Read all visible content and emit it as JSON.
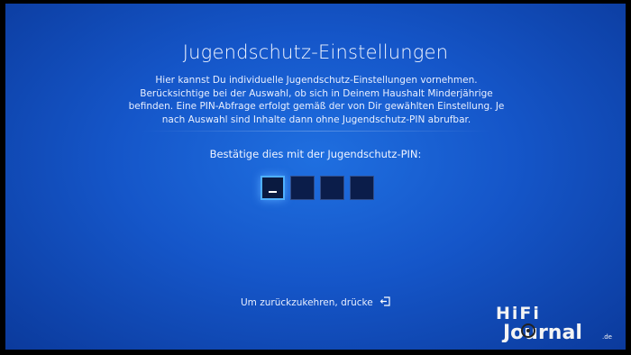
{
  "screen": {
    "title": "Jugendschutz-Einstellungen",
    "description": "Hier kannst Du individuelle Jugendschutz-Einstellungen vornehmen. Berücksichtige bei der Auswahl, ob sich in Deinem Haushalt Minderjährige befinden. Eine PIN-Abfrage erfolgt gemäß der von Dir gewählten Einstellung. Je nach Auswahl sind Inhalte dann ohne Jugendschutz-PIN abrufbar.",
    "pin_prompt": "Bestätige dies mit der Jugendschutz-PIN:",
    "pin_digits": 4,
    "back_hint": "Um zurückzukehren, drücke"
  },
  "watermark": {
    "line1": "HiFi",
    "line2": "Journal",
    "suffix": ".de"
  },
  "colors": {
    "background": "#1556c9",
    "pin_active_border": "#4fb0ff",
    "pin_box": "#0b1d4a"
  },
  "icons": {
    "back": "back-return-icon"
  }
}
